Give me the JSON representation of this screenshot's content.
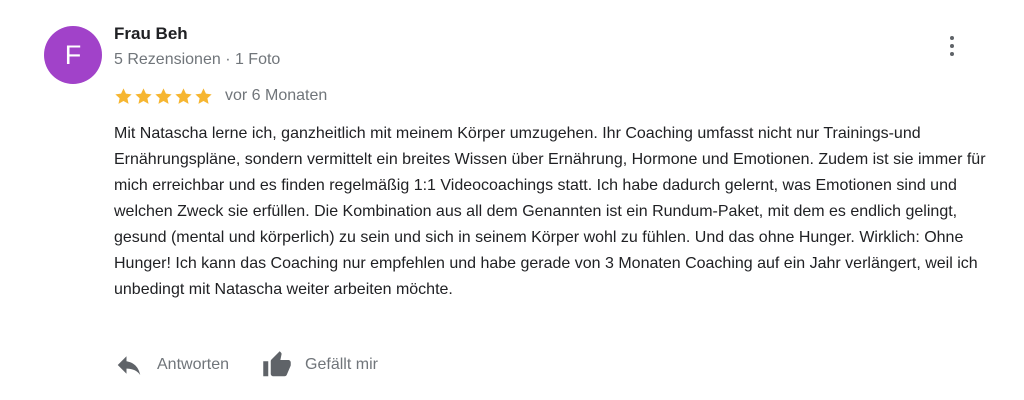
{
  "review": {
    "author": {
      "initial": "F",
      "name": "Frau Beh",
      "meta": "5 Rezensionen · 1 Foto",
      "avatar_color": "#a142c9"
    },
    "rating": {
      "stars": 5,
      "max": 5,
      "star_color": "#f6b631"
    },
    "time": "vor 6 Monaten",
    "text": "Mit Natascha lerne ich, ganzheitlich mit meinem Körper umzugehen. Ihr Coaching umfasst nicht nur Trainings-und Ernährungspläne, sondern vermittelt ein breites Wissen über Ernährung, Hormone und Emotionen. Zudem ist sie immer für mich erreichbar und es finden regelmäßig 1:1 Videocoachings statt. Ich habe dadurch gelernt, was Emotionen sind und welchen Zweck sie erfüllen. Die Kombination aus all dem Genannten ist ein Rundum-Paket, mit dem es endlich gelingt, gesund (mental und körperlich) zu sein und sich in seinem Körper wohl zu fühlen. Und das ohne Hunger. Wirklich: Ohne Hunger! Ich kann das Coaching nur empfehlen und habe gerade von 3 Monaten Coaching auf ein Jahr verlängert, weil ich unbedingt mit Natascha weiter arbeiten möchte.",
    "more_icon": "more-vert-icon"
  },
  "actions": {
    "reply": {
      "label": "Antworten",
      "icon": "reply-icon"
    },
    "like": {
      "label": "Gefällt mir",
      "icon": "thumbs-up-icon"
    }
  }
}
